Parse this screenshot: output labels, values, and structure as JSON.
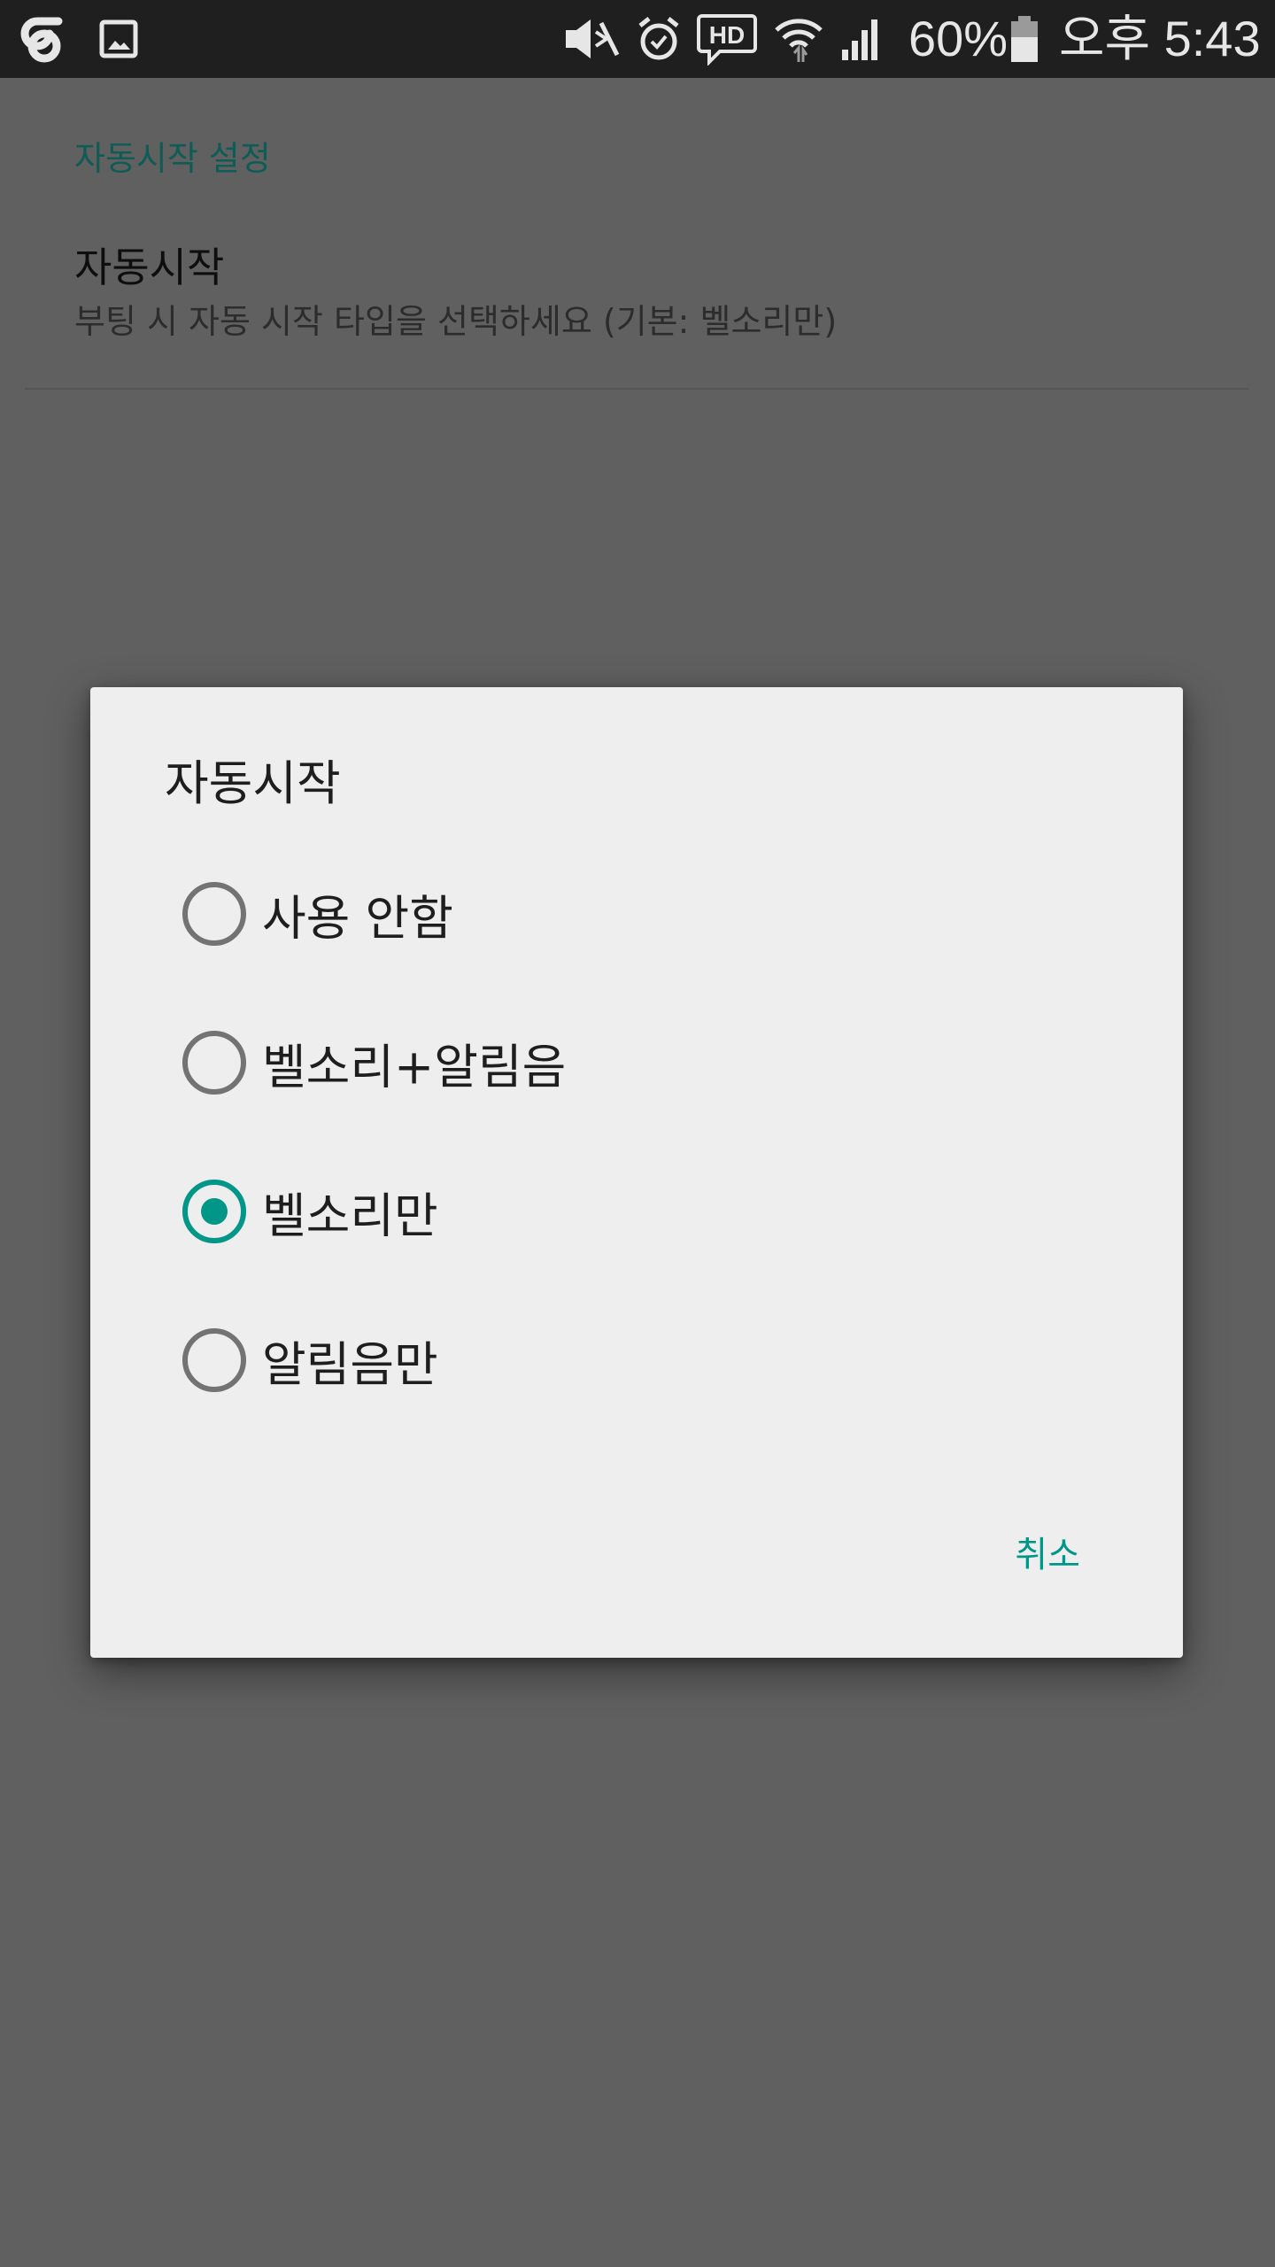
{
  "status_bar": {
    "battery_percent": "60%",
    "time": "오후 5:43",
    "icons": [
      "carrier-logo-icon",
      "gallery-notification-icon",
      "mute-icon",
      "alarm-icon",
      "hd-voice-icon",
      "wifi-icon",
      "signal-icon",
      "battery-icon"
    ]
  },
  "settings": {
    "category_header": "자동시작 설정",
    "pref_title": "자동시작",
    "pref_summary": "부팅 시 자동 시작 타입을 선택하세요 (기본: 벨소리만)"
  },
  "dialog": {
    "title": "자동시작",
    "options": [
      {
        "label": "사용 안함",
        "checked": false
      },
      {
        "label": "벨소리+알림음",
        "checked": false
      },
      {
        "label": "벨소리만",
        "checked": true
      },
      {
        "label": "알림음만",
        "checked": false
      }
    ],
    "cancel_label": "취소"
  },
  "colors": {
    "accent": "#009688",
    "scrim_background": "#606060",
    "status_bar": "#1f1f1f",
    "dialog_background": "#eeeeee"
  }
}
